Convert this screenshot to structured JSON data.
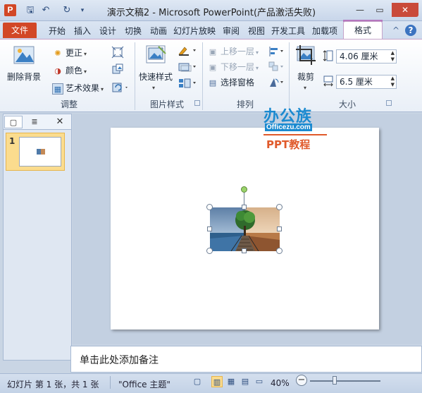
{
  "titlebar": {
    "app_letter": "P",
    "title": "演示文稿2 - Microsoft PowerPoint(产品激活失败)",
    "qat_save": "🖫",
    "qat_undo": "↶",
    "qat_redo": "↻",
    "qat_more": "▾",
    "minimize": "—",
    "maximize": "▭",
    "close": "✕"
  },
  "tabs": {
    "file": "文件",
    "items": [
      "开始",
      "插入",
      "设计",
      "切换",
      "动画",
      "幻灯片放映",
      "审阅",
      "视图",
      "开发工具",
      "加载项"
    ],
    "format": "格式",
    "collapse_icon": "^",
    "help_icon": "?"
  },
  "ribbon": {
    "adjust": {
      "remove_bg": "删除背景",
      "corrections": "更正",
      "color": "颜色",
      "artistic": "艺术效果",
      "label": "调整"
    },
    "picture_styles": {
      "quick_styles": "快速样式",
      "label": "图片样式"
    },
    "arrange": {
      "bring_forward": "上移一层",
      "send_backward": "下移一层",
      "selection_pane": "选择窗格",
      "label": "排列"
    },
    "size": {
      "crop": "裁剪",
      "height": "4.06 厘米",
      "width": "6.5 厘米",
      "label": "大小"
    }
  },
  "left_panel": {
    "close": "✕",
    "slide_number": "1"
  },
  "watermark": {
    "title": "办公族",
    "site": "Officezu.com",
    "subtitle": "PPT教程"
  },
  "notes": {
    "placeholder": "单击此处添加备注"
  },
  "statusbar": {
    "slide_info": "幻灯片 第 1 张，共 1 张",
    "theme": "\"Office 主题\"",
    "zoom": "40%",
    "zoom_minus": "−"
  }
}
